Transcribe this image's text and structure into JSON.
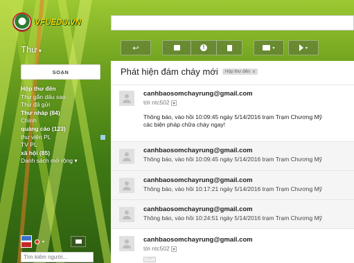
{
  "logo": {
    "text": "VFUEDU.VN"
  },
  "mail_label": "Thư",
  "toolbar": {
    "back_icon": "arrow-back-icon",
    "archive_icon": "archive-icon",
    "spam_icon": "report-spam-icon",
    "delete_icon": "trash-icon",
    "move_icon": "folder-icon",
    "label_icon": "label-icon"
  },
  "compose_label": "SOẠN",
  "nav": [
    {
      "label": "Hộp thư đến",
      "bold": true
    },
    {
      "label": "Thư gắn dấu sao",
      "bold": false
    },
    {
      "label": "Thư đã gửi",
      "bold": false
    },
    {
      "label": "Thư nháp (84)",
      "bold": true
    },
    {
      "label": "Chính",
      "bold": false
    },
    {
      "label": "quảng cáo (123)",
      "bold": true
    },
    {
      "label": "thư viện PL",
      "bold": false
    },
    {
      "label": "TV PL",
      "bold": false
    },
    {
      "label": "xã hội (85)",
      "bold": true
    },
    {
      "label": "Danh sách mở rộng ▾",
      "bold": false
    }
  ],
  "people_search_placeholder": "Tìm kiếm người...",
  "conversation": {
    "subject": "Phát hiện đám cháy mới",
    "tag": "Hộp thư đến",
    "tag_close": "x",
    "messages": [
      {
        "sender": "canhbaosomchayrung@gmail.com",
        "to": "tới ntc502",
        "body_line1": "Thông báo, vào hồi 10:09:45 ngày 5/14/2016 trạm Trạm Chương Mỹ",
        "body_line2": "các biện pháp chữa cháy ngay!"
      },
      {
        "sender": "canhbaosomchayrung@gmail.com",
        "snippet": "Thông báo, vào hồi 10:09:45 ngày 5/14/2016 trạm Trạm Chương Mỹ"
      },
      {
        "sender": "canhbaosomchayrung@gmail.com",
        "snippet": "Thông báo, vào hồi 10:17:21 ngày 5/14/2016 trạm Trạm Chương Mỹ"
      },
      {
        "sender": "canhbaosomchayrung@gmail.com",
        "snippet": "Thông báo, vào hồi 10:24:51 ngày 5/14/2016 trạm Trạm Chương Mỹ"
      },
      {
        "sender": "canhbaosomchayrung@gmail.com",
        "to": "tới ntc502",
        "ellipsis": "···"
      }
    ]
  }
}
